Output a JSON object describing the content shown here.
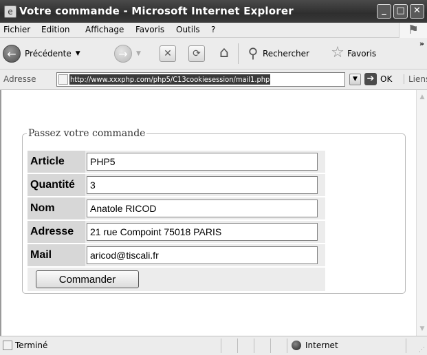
{
  "window": {
    "title": "Votre commande - Microsoft Internet Explorer",
    "controls": {
      "minimize": "_",
      "maximize": "□",
      "close": "✕"
    }
  },
  "menubar": {
    "items": [
      "Fichier",
      "Edition",
      "Affichage",
      "Favoris",
      "Outils",
      "?"
    ]
  },
  "toolbar": {
    "back_label": "Précédente",
    "search_label": "Rechercher",
    "favorites_label": "Favoris",
    "overflow": "»"
  },
  "addressbar": {
    "label": "Adresse",
    "url": "http://www.xxxphp.com/php5/C13cookiesession/mail1.php",
    "go_label": "OK",
    "links_label": "Liens"
  },
  "form": {
    "legend": "Passez votre commande",
    "fields": [
      {
        "label": "Article",
        "value": "PHP5"
      },
      {
        "label": "Quantité",
        "value": "3"
      },
      {
        "label": "Nom",
        "value": "Anatole RICOD"
      },
      {
        "label": "Adresse",
        "value": "21 rue Compoint 75018 PARIS"
      },
      {
        "label": "Mail",
        "value": "aricod@tiscali.fr"
      }
    ],
    "submit_label": "Commander"
  },
  "statusbar": {
    "status": "Terminé",
    "zone": "Internet"
  }
}
